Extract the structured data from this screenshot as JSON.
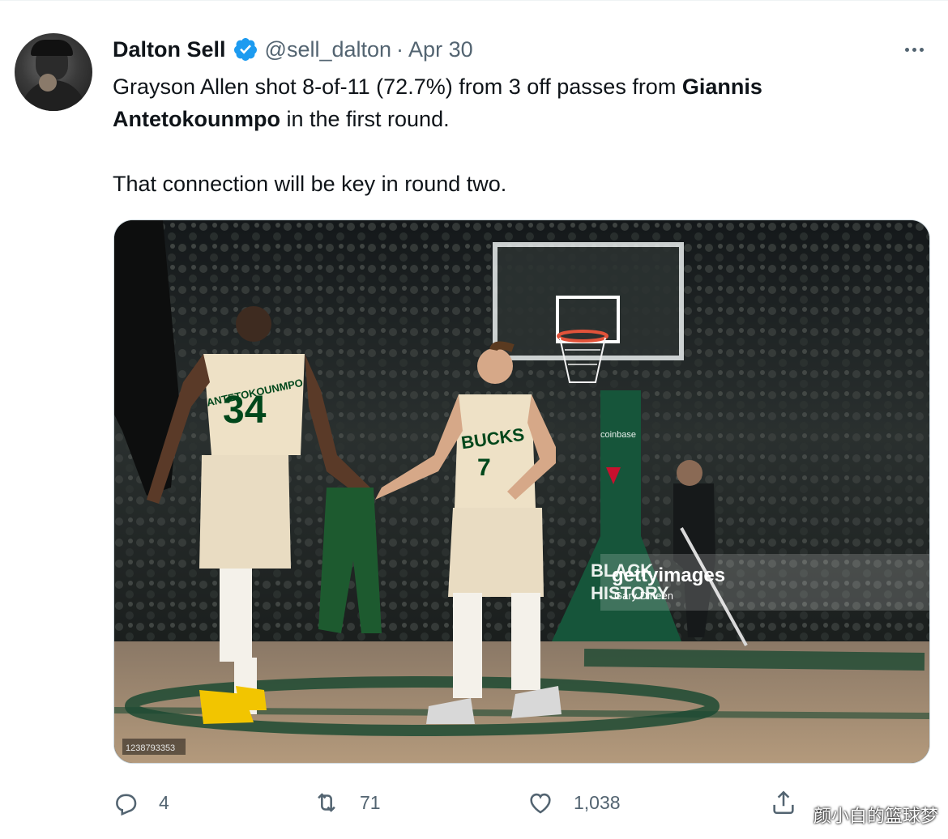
{
  "author": {
    "name": "Dalton Sell",
    "handle": "@sell_dalton",
    "separator": "·",
    "date": "Apr 30",
    "verified": true
  },
  "tweet": {
    "line1_a": "Grayson Allen shot 8-of-11 (72.7%) from 3 off passes from ",
    "line1_bold": "Giannis",
    "line2_bold": "Antetokounmpo",
    "line2_b": " in the first round.",
    "line3": "That connection will be key in round two."
  },
  "media": {
    "jersey_giannis_name": "ANTETOKOUNMPO",
    "jersey_giannis_number": "34",
    "jersey_allen_team": "BUCKS",
    "jersey_allen_number": "7",
    "getty_logo": "gettyimages",
    "getty_credit": "Gary Dineen",
    "floor_text_1": "BLACK",
    "floor_text_2": "HISTORY",
    "image_id": "1238793353",
    "stanchion_text": "coinbase"
  },
  "actions": {
    "reply_count": "4",
    "retweet_count": "71",
    "like_count": "1,038"
  },
  "icons": {
    "reply": "reply-icon",
    "retweet": "retweet-icon",
    "like": "heart-icon",
    "share": "share-icon",
    "more": "more-icon",
    "verified": "verified-badge-icon"
  },
  "colors": {
    "verified_blue": "#1d9bf0",
    "secondary_text": "#536471",
    "bucks_green": "#00471b",
    "bucks_cream": "#eee1c6"
  },
  "watermark": "颜小白的篮球梦"
}
